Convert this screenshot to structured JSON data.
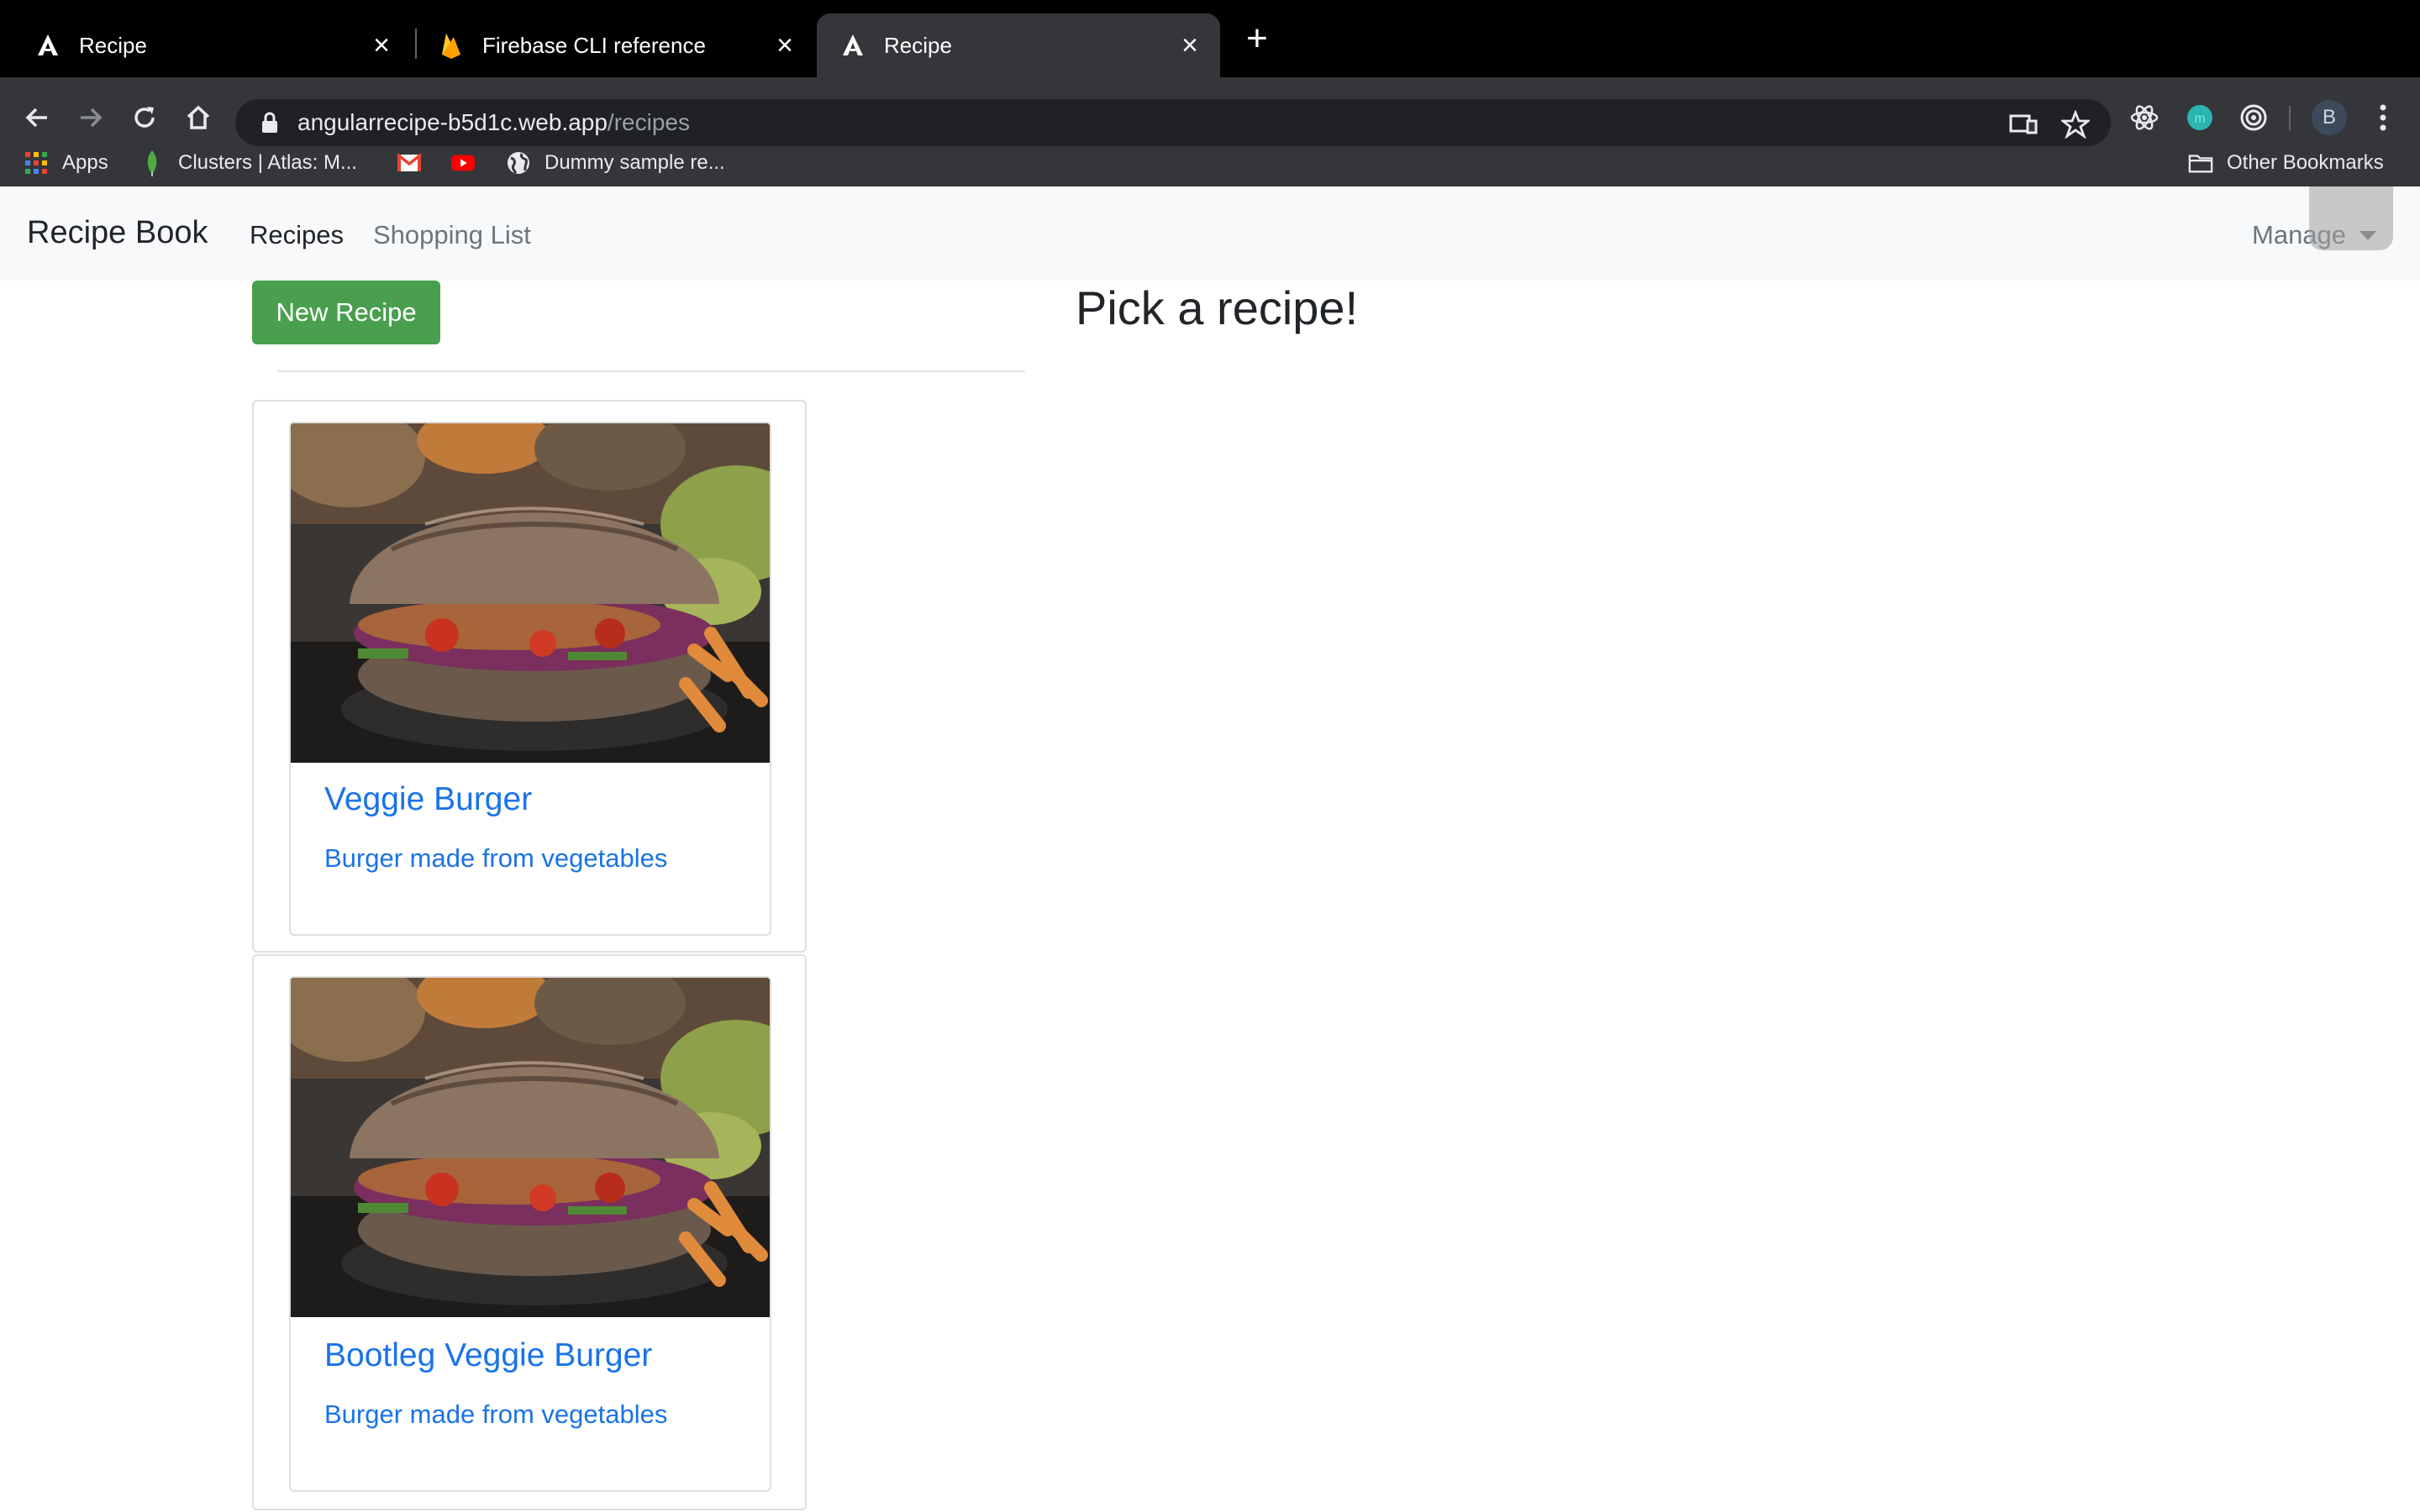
{
  "browser": {
    "tabs": [
      {
        "title": "Recipe",
        "favicon": "angular-icon",
        "active": false
      },
      {
        "title": "Firebase CLI reference",
        "favicon": "firebase-icon",
        "active": false
      },
      {
        "title": "Recipe",
        "favicon": "angular-icon",
        "active": true
      }
    ],
    "url_host": "angularrecipe-b5d1c.web.app",
    "url_path": "/recipes",
    "bookmarks": [
      {
        "label": "Apps",
        "icon": "apps-grid-icon"
      },
      {
        "label": "Clusters | Atlas: M...",
        "icon": "mongodb-leaf-icon"
      },
      {
        "label": "",
        "icon": "gmail-icon"
      },
      {
        "label": "",
        "icon": "youtube-icon"
      },
      {
        "label": "Dummy sample re...",
        "icon": "globe-icon"
      }
    ],
    "other_bookmarks": "Other Bookmarks",
    "profile_initial": "B"
  },
  "app": {
    "brand": "Recipe Book",
    "nav": {
      "recipes": "Recipes",
      "shopping_list": "Shopping List",
      "manage": "Manage"
    },
    "new_recipe_button": "New Recipe",
    "detail_heading": "Pick a recipe!",
    "recipes": [
      {
        "name": "Veggie Burger",
        "description": "Burger made from vegetables"
      },
      {
        "name": "Bootleg Veggie Burger",
        "description": "Burger made from vegetables"
      }
    ]
  },
  "colors": {
    "link": "#1a73e8",
    "success": "#4a9f4e",
    "navbar_bg": "#f8f9fa",
    "chrome_dark": "#35363a"
  }
}
